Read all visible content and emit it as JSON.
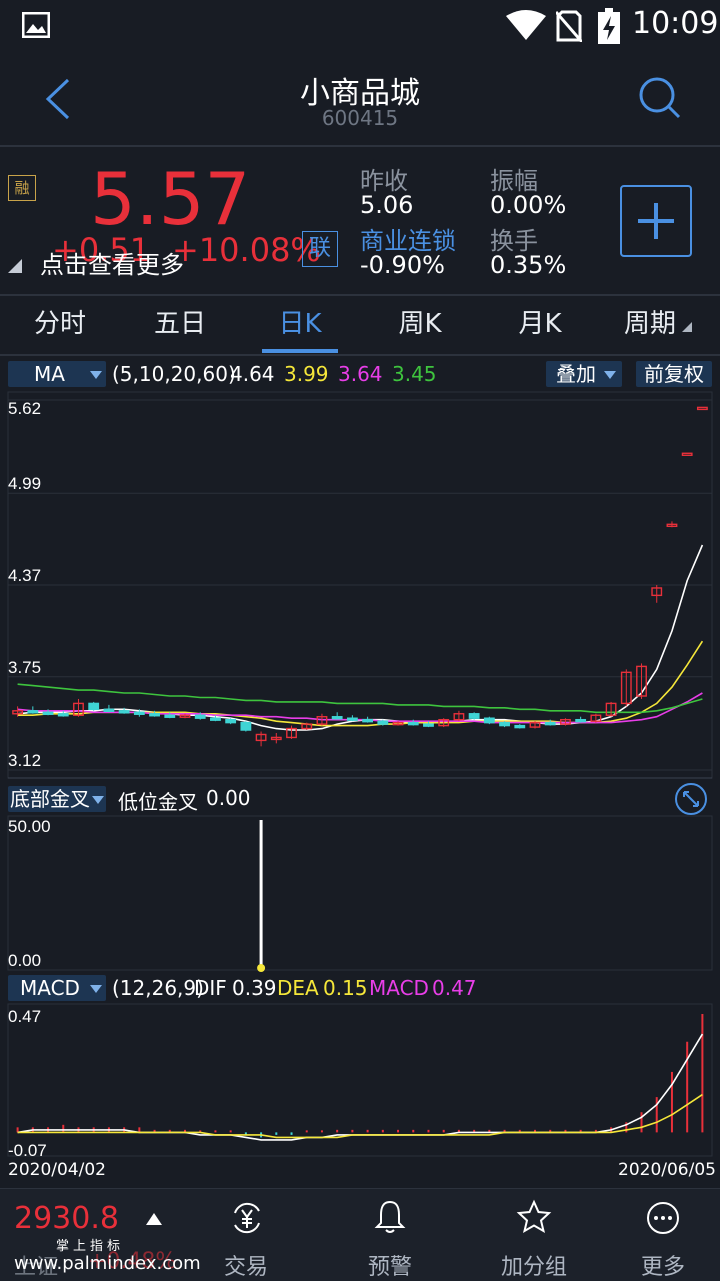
{
  "status_bar": {
    "time": "10:09",
    "icons": [
      "image-icon",
      "wifi-icon",
      "no-sim-icon",
      "battery-charging-icon"
    ]
  },
  "header": {
    "title": "小商品城",
    "code": "600415"
  },
  "quote": {
    "badge": "融",
    "price": "5.57",
    "change": "+0.51",
    "change_pct": "+10.08%",
    "link_badge": "联",
    "more_hint": "点击查看更多",
    "prev_close_label": "昨收",
    "prev_close": "5.06",
    "amplitude_label": "振幅",
    "amplitude": "0.00%",
    "sector_label": "商业连锁",
    "sector_change": "-0.90%",
    "turnover_label": "换手",
    "turnover": "0.35%"
  },
  "tabs": [
    "分时",
    "五日",
    "日K",
    "周K",
    "月K",
    "周期"
  ],
  "active_tab": 2,
  "ma_bar": {
    "indicator": "MA",
    "params": "(5,10,20,60)",
    "values": [
      "4.64",
      "3.99",
      "3.64",
      "3.45"
    ],
    "colors": [
      "#ffffff",
      "#f5e73a",
      "#e83ee8",
      "#3ec43e"
    ],
    "overlay": "叠加",
    "adjust": "前复权"
  },
  "chart_data": [
    {
      "type": "candlestick",
      "name": "daily-k",
      "ylim": [
        3.12,
        5.62
      ],
      "yticks": [
        "5.62",
        "4.99",
        "4.37",
        "3.75",
        "3.12"
      ],
      "x_range": [
        "2020/04/02",
        "2020/06/05"
      ],
      "candles": [
        [
          3.5,
          3.55,
          3.48,
          3.52
        ],
        [
          3.52,
          3.55,
          3.5,
          3.51
        ],
        [
          3.51,
          3.53,
          3.49,
          3.5
        ],
        [
          3.5,
          3.52,
          3.48,
          3.49
        ],
        [
          3.49,
          3.6,
          3.48,
          3.57
        ],
        [
          3.57,
          3.58,
          3.52,
          3.53
        ],
        [
          3.53,
          3.56,
          3.51,
          3.52
        ],
        [
          3.52,
          3.54,
          3.5,
          3.51
        ],
        [
          3.51,
          3.53,
          3.48,
          3.5
        ],
        [
          3.5,
          3.52,
          3.48,
          3.49
        ],
        [
          3.49,
          3.51,
          3.47,
          3.48
        ],
        [
          3.48,
          3.5,
          3.47,
          3.49
        ],
        [
          3.49,
          3.51,
          3.46,
          3.47
        ],
        [
          3.47,
          3.49,
          3.45,
          3.46
        ],
        [
          3.46,
          3.47,
          3.43,
          3.44
        ],
        [
          3.44,
          3.45,
          3.38,
          3.39
        ],
        [
          3.32,
          3.38,
          3.28,
          3.36
        ],
        [
          3.33,
          3.37,
          3.3,
          3.34
        ],
        [
          3.34,
          3.42,
          3.33,
          3.4
        ],
        [
          3.4,
          3.44,
          3.39,
          3.43
        ],
        [
          3.43,
          3.5,
          3.42,
          3.48
        ],
        [
          3.48,
          3.51,
          3.46,
          3.47
        ],
        [
          3.47,
          3.49,
          3.45,
          3.46
        ],
        [
          3.46,
          3.48,
          3.44,
          3.45
        ],
        [
          3.45,
          3.46,
          3.42,
          3.43
        ],
        [
          3.43,
          3.45,
          3.42,
          3.44
        ],
        [
          3.44,
          3.46,
          3.42,
          3.43
        ],
        [
          3.43,
          3.45,
          3.41,
          3.42
        ],
        [
          3.42,
          3.47,
          3.41,
          3.46
        ],
        [
          3.46,
          3.52,
          3.45,
          3.5
        ],
        [
          3.5,
          3.51,
          3.46,
          3.47
        ],
        [
          3.47,
          3.48,
          3.43,
          3.44
        ],
        [
          3.44,
          3.45,
          3.41,
          3.42
        ],
        [
          3.42,
          3.43,
          3.4,
          3.41
        ],
        [
          3.41,
          3.45,
          3.4,
          3.44
        ],
        [
          3.44,
          3.46,
          3.42,
          3.43
        ],
        [
          3.43,
          3.47,
          3.42,
          3.46
        ],
        [
          3.46,
          3.48,
          3.44,
          3.45
        ],
        [
          3.45,
          3.5,
          3.44,
          3.49
        ],
        [
          3.49,
          3.58,
          3.48,
          3.57
        ],
        [
          3.57,
          3.8,
          3.55,
          3.78
        ],
        [
          3.62,
          3.84,
          3.6,
          3.82
        ],
        [
          4.3,
          4.37,
          4.25,
          4.35
        ],
        [
          4.78,
          4.8,
          4.76,
          4.78
        ],
        [
          5.26,
          5.26,
          5.26,
          5.26
        ],
        [
          5.57,
          5.57,
          5.57,
          5.57
        ]
      ],
      "ma_series": [
        {
          "name": "MA5",
          "color": "#ffffff",
          "values": [
            3.5,
            3.51,
            3.51,
            3.51,
            3.52,
            3.52,
            3.53,
            3.53,
            3.52,
            3.51,
            3.5,
            3.49,
            3.49,
            3.48,
            3.47,
            3.45,
            3.42,
            3.4,
            3.39,
            3.39,
            3.4,
            3.43,
            3.45,
            3.46,
            3.46,
            3.45,
            3.44,
            3.44,
            3.44,
            3.45,
            3.46,
            3.46,
            3.46,
            3.45,
            3.44,
            3.43,
            3.43,
            3.44,
            3.45,
            3.48,
            3.55,
            3.64,
            3.8,
            4.06,
            4.4,
            4.64
          ]
        },
        {
          "name": "MA10",
          "color": "#f5e73a",
          "values": [
            3.49,
            3.49,
            3.5,
            3.5,
            3.5,
            3.51,
            3.51,
            3.51,
            3.51,
            3.51,
            3.51,
            3.51,
            3.5,
            3.5,
            3.49,
            3.48,
            3.47,
            3.45,
            3.44,
            3.43,
            3.42,
            3.42,
            3.42,
            3.42,
            3.43,
            3.43,
            3.44,
            3.44,
            3.44,
            3.44,
            3.45,
            3.45,
            3.45,
            3.45,
            3.45,
            3.45,
            3.44,
            3.44,
            3.44,
            3.45,
            3.47,
            3.51,
            3.57,
            3.68,
            3.83,
            3.99
          ]
        },
        {
          "name": "MA20",
          "color": "#e83ee8",
          "values": [
            3.53,
            3.52,
            3.52,
            3.52,
            3.52,
            3.51,
            3.51,
            3.51,
            3.51,
            3.5,
            3.5,
            3.5,
            3.5,
            3.49,
            3.49,
            3.49,
            3.48,
            3.48,
            3.47,
            3.47,
            3.46,
            3.46,
            3.46,
            3.46,
            3.45,
            3.45,
            3.45,
            3.45,
            3.45,
            3.45,
            3.45,
            3.44,
            3.44,
            3.44,
            3.44,
            3.44,
            3.44,
            3.44,
            3.44,
            3.44,
            3.45,
            3.46,
            3.48,
            3.53,
            3.58,
            3.64
          ]
        },
        {
          "name": "MA60",
          "color": "#3ec43e",
          "values": [
            3.7,
            3.69,
            3.68,
            3.67,
            3.66,
            3.66,
            3.65,
            3.64,
            3.64,
            3.63,
            3.62,
            3.62,
            3.61,
            3.61,
            3.6,
            3.59,
            3.59,
            3.58,
            3.58,
            3.58,
            3.58,
            3.57,
            3.57,
            3.57,
            3.57,
            3.56,
            3.56,
            3.56,
            3.55,
            3.55,
            3.55,
            3.54,
            3.54,
            3.53,
            3.53,
            3.52,
            3.52,
            3.52,
            3.51,
            3.51,
            3.51,
            3.51,
            3.52,
            3.54,
            3.57,
            3.6
          ]
        }
      ]
    },
    {
      "type": "bar",
      "name": "bottom-golden-cross",
      "ylim": [
        0,
        50
      ],
      "yticks": [
        "50.00",
        "0.00"
      ],
      "signal_index": 16
    },
    {
      "type": "macd",
      "name": "macd",
      "ylim": [
        -0.07,
        0.47
      ],
      "yticks": [
        "0.47",
        "-0.07"
      ],
      "dif": [
        0.0,
        0.01,
        0.01,
        0.01,
        0.01,
        0.01,
        0.01,
        0.01,
        0.0,
        0.0,
        0.0,
        0.0,
        -0.01,
        -0.01,
        -0.01,
        -0.02,
        -0.03,
        -0.03,
        -0.03,
        -0.02,
        -0.02,
        -0.01,
        -0.01,
        -0.01,
        -0.01,
        -0.01,
        -0.01,
        -0.01,
        -0.01,
        0.0,
        0.0,
        0.0,
        0.0,
        0.0,
        0.0,
        0.0,
        0.0,
        0.0,
        0.0,
        0.01,
        0.03,
        0.06,
        0.11,
        0.19,
        0.29,
        0.39
      ],
      "dea": [
        0.0,
        0.0,
        0.0,
        0.0,
        0.0,
        0.0,
        0.0,
        0.0,
        0.0,
        0.0,
        0.0,
        0.0,
        0.0,
        -0.01,
        -0.01,
        -0.01,
        -0.01,
        -0.02,
        -0.02,
        -0.02,
        -0.02,
        -0.02,
        -0.01,
        -0.01,
        -0.01,
        -0.01,
        -0.01,
        -0.01,
        -0.01,
        -0.01,
        -0.01,
        -0.01,
        0.0,
        0.0,
        0.0,
        0.0,
        0.0,
        0.0,
        0.0,
        0.0,
        0.01,
        0.02,
        0.04,
        0.07,
        0.11,
        0.15
      ],
      "macd": [
        0.02,
        0.02,
        0.02,
        0.03,
        0.02,
        0.02,
        0.02,
        0.02,
        0.02,
        0.01,
        0.01,
        0.01,
        0.0,
        0.0,
        0.0,
        -0.01,
        -0.02,
        -0.01,
        -0.01,
        0.0,
        0.0,
        0.01,
        0.01,
        0.01,
        0.01,
        0.01,
        0.01,
        0.01,
        0.01,
        0.01,
        0.01,
        0.01,
        0.01,
        0.01,
        0.01,
        0.01,
        0.01,
        0.01,
        0.01,
        0.02,
        0.04,
        0.08,
        0.14,
        0.24,
        0.36,
        0.47
      ]
    }
  ],
  "signal_bar": {
    "indicator": "底部金叉",
    "label": "低位金叉",
    "value": "0.00"
  },
  "macd_bar": {
    "indicator": "MACD",
    "params": "(12,26,9)",
    "dif_label": "DIF",
    "dif": "0.39",
    "dea_label": "DEA",
    "dea": "0.15",
    "macd_label": "MACD",
    "macd": "0.47"
  },
  "x_axis": {
    "start": "2020/04/02",
    "end": "2020/06/05"
  },
  "bottom_nav": {
    "index_value": "2930.8",
    "index_name": "上证",
    "index_pct": "+0.48%",
    "items": [
      {
        "label": "交易",
        "icon": "yuan-exchange-icon"
      },
      {
        "label": "预警",
        "icon": "bell-icon"
      },
      {
        "label": "加分组",
        "icon": "star-icon"
      },
      {
        "label": "更多",
        "icon": "more-icon"
      }
    ]
  },
  "watermark": {
    "top": "掌上指标",
    "bottom": "www.palmindex.com"
  },
  "colors": {
    "up": "#e8303a",
    "down": "#3fd4d4",
    "accent": "#4a90e2",
    "bg": "#181c24",
    "grid": "#2a303a"
  }
}
